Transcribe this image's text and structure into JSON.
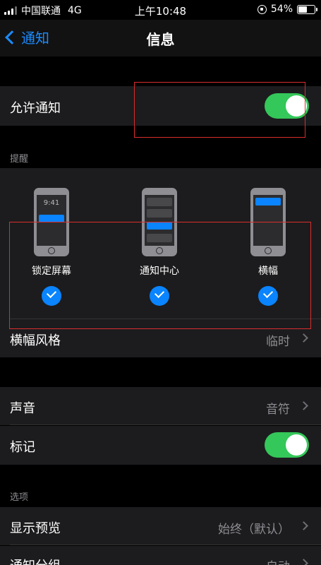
{
  "status_bar": {
    "carrier": "中国联通",
    "network": "4G",
    "time": "上午10:48",
    "battery": "54%",
    "battery_level": 0.54
  },
  "nav": {
    "back_label": "通知",
    "title": "信息"
  },
  "allow_notifications": {
    "label": "允许通知",
    "enabled": true
  },
  "alerts": {
    "header": "提醒",
    "lock_screen_time": "9:41",
    "items": [
      {
        "label": "锁定屏幕",
        "checked": true
      },
      {
        "label": "通知中心",
        "checked": true
      },
      {
        "label": "横幅",
        "checked": true
      }
    ],
    "banner_style": {
      "label": "横幅风格",
      "value": "临时"
    }
  },
  "sounds": {
    "label": "声音",
    "value": "音符"
  },
  "badges": {
    "label": "标记",
    "enabled": true
  },
  "options": {
    "header": "选项",
    "show_previews": {
      "label": "显示预览",
      "value": "始终（默认）"
    },
    "grouping": {
      "label": "通知分组",
      "value": "自动"
    }
  },
  "colors": {
    "accent": "#0a84ff",
    "toggle_on": "#34c759",
    "annotation": "#d92d2d"
  }
}
